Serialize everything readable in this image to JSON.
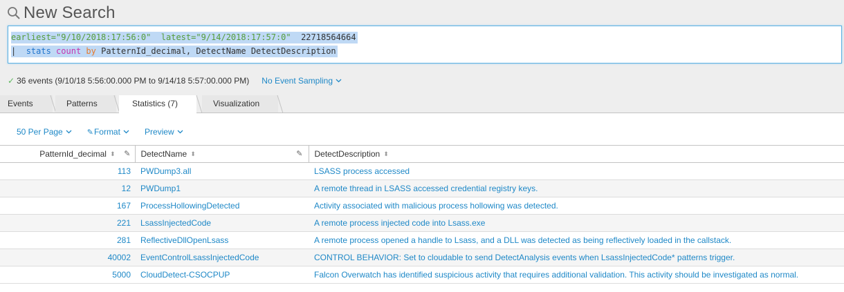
{
  "header": {
    "title": "New Search",
    "icon": "search-icon"
  },
  "query": {
    "line1": {
      "earliest_key": "earliest=",
      "earliest_val": "\"9/10/2018:17:56:0\"",
      "latest_key": "latest=",
      "latest_val": "\"9/14/2018:17:57:0\"",
      "term": "22718564664"
    },
    "line2": {
      "pipe": "|",
      "command": "stats",
      "function": "count",
      "by": "by",
      "fields": "PatternId_decimal, DetectName DetectDescription"
    }
  },
  "status": {
    "events": "36 events (9/10/18 5:56:00.000 PM to 9/14/18 5:57:00.000 PM)",
    "sampling": "No Event Sampling",
    "success_color": "#5cb85c"
  },
  "tabs": [
    {
      "label": "Events",
      "active": false
    },
    {
      "label": "Patterns",
      "active": false
    },
    {
      "label": "Statistics (7)",
      "active": true
    },
    {
      "label": "Visualization",
      "active": false
    }
  ],
  "toolbar": {
    "per_page": "50 Per Page",
    "format": "Format",
    "preview": "Preview"
  },
  "table": {
    "columns": [
      "PatternId_decimal",
      "DetectName",
      "DetectDescription"
    ],
    "rows": [
      [
        "113",
        "PWDump3.all",
        "LSASS process accessed"
      ],
      [
        "12",
        "PWDump1",
        "A remote thread in LSASS accessed credential registry keys."
      ],
      [
        "167",
        "ProcessHollowingDetected",
        "Activity associated with malicious process hollowing was detected."
      ],
      [
        "221",
        "LsassInjectedCode",
        "A remote process injected code into Lsass.exe"
      ],
      [
        "281",
        "ReflectiveDllOpenLsass",
        "A remote process opened a handle to Lsass, and a DLL was detected as being reflectively loaded in the callstack."
      ],
      [
        "40002",
        "EventControlLsassInjectedCode",
        "CONTROL BEHAVIOR: Set to cloudable to send DetectAnalysis events when LsassInjectedCode* patterns trigger."
      ],
      [
        "5000",
        "CloudDetect-CSOCPUP",
        "Falcon Overwatch has identified suspicious activity that requires additional validation. This activity should be investigated as normal."
      ]
    ]
  },
  "colors": {
    "link": "#1e88c7",
    "accent": "#5cb0e2"
  }
}
